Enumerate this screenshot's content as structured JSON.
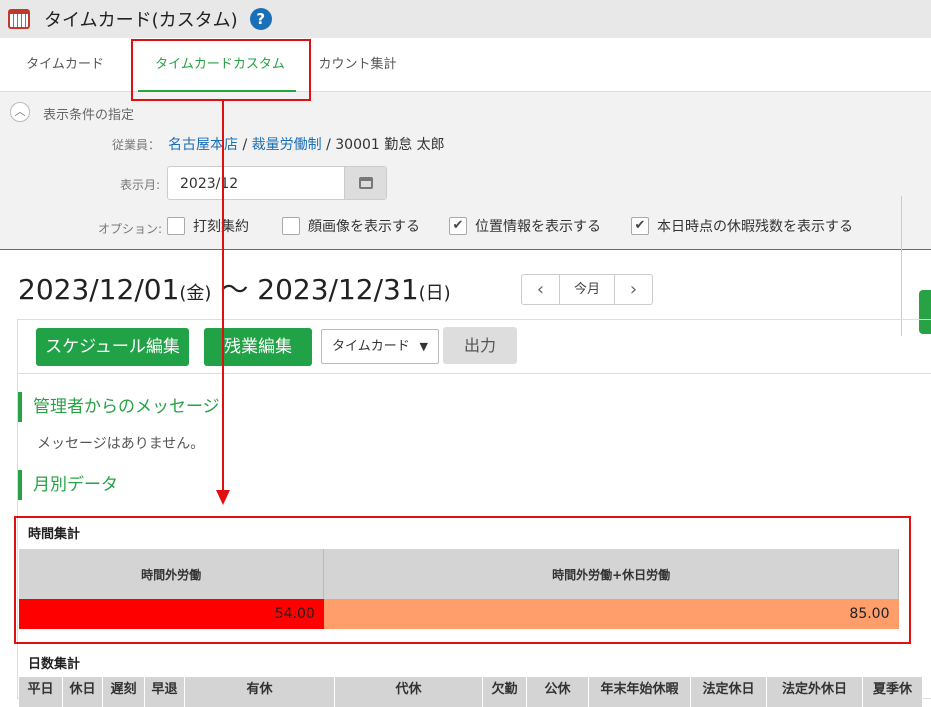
{
  "app": {
    "title": "タイムカード(カスタム)"
  },
  "tabs": [
    "タイムカード",
    "タイムカードカスタム",
    "カウント集計"
  ],
  "conditions": {
    "title": "表示条件の指定",
    "employee_label": "従業員：",
    "employee_store": "名古屋本店",
    "employee_type": "裁量労働制",
    "employee_rest": "30001 勤怠 太郎",
    "sep": "/",
    "month_label": "表示月:",
    "month_value": "2023/12",
    "options_label": "オプション:",
    "options": [
      {
        "label": "打刻集約",
        "checked": false
      },
      {
        "label": "顔画像を表示する",
        "checked": false
      },
      {
        "label": "位置情報を表示する",
        "checked": true
      },
      {
        "label": "本日時点の休暇残数を表示する",
        "checked": true
      }
    ]
  },
  "period": {
    "start": "2023/12/01",
    "start_dow": "(金)",
    "sep": " ～ ",
    "end": "2023/12/31",
    "end_dow": "(日)"
  },
  "nav": {
    "prev": "‹",
    "current": "今月",
    "next": "›"
  },
  "toolbar": {
    "schedule_edit": "スケジュール編集",
    "overtime_edit": "残業編集",
    "select_value": "タイムカード",
    "output": "出力"
  },
  "sections": {
    "message_title": "管理者からのメッセージ",
    "message_body": "メッセージはありません。",
    "monthly_title": "月別データ"
  },
  "time_summary": {
    "title": "時間集計",
    "columns": [
      "時間外労働",
      "時間外労働+休日労働"
    ],
    "values": [
      "54.00",
      "85.00"
    ],
    "colors": [
      "#ff0000",
      "#ff9e6a"
    ]
  },
  "day_summary": {
    "title": "日数集計",
    "columns": [
      "平日",
      "休日",
      "遅刻",
      "早退",
      "有休",
      "代休",
      "欠勤",
      "公休",
      "年末年始休暇",
      "法定休日",
      "法定外休日",
      "夏季休"
    ]
  }
}
